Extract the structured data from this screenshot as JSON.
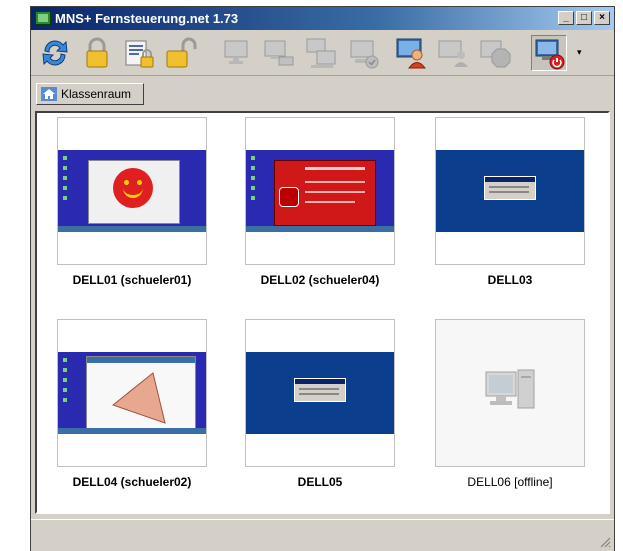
{
  "window": {
    "title": "MNS+ Fernsteuerung.net 1.73",
    "controls": {
      "minimize": "_",
      "maximize": "□",
      "close": "×"
    }
  },
  "toolbar": {
    "buttons": [
      {
        "icon": "refresh-icon",
        "enabled": true
      },
      {
        "icon": "lock-icon",
        "enabled": true
      },
      {
        "icon": "lock-document-icon",
        "enabled": true
      },
      {
        "icon": "unlock-icon",
        "enabled": true
      },
      {
        "icon": "computer-icon",
        "enabled": false
      },
      {
        "icon": "computer-network-icon",
        "enabled": false
      },
      {
        "icon": "computer-share-icon",
        "enabled": false
      },
      {
        "icon": "computer-check-icon",
        "enabled": false
      },
      {
        "icon": "user-view-icon",
        "enabled": true
      },
      {
        "icon": "computer-user-icon",
        "enabled": false
      },
      {
        "icon": "stop-icon",
        "enabled": false
      },
      {
        "icon": "power-off-icon",
        "enabled": true
      }
    ],
    "dropdown_glyph": "▾"
  },
  "tab": {
    "label": "Klassenraum",
    "icon": "home-icon"
  },
  "clients": [
    {
      "label": "DELL01 (schueler01)",
      "state": "smiley",
      "online": true
    },
    {
      "label": "DELL02 (schueler04)",
      "state": "stop-alert",
      "online": true
    },
    {
      "label": "DELL03",
      "state": "login",
      "online": true
    },
    {
      "label": "DELL04 (schueler02)",
      "state": "geometry",
      "online": true
    },
    {
      "label": "DELL05",
      "state": "login",
      "online": true
    },
    {
      "label": "DELL06 [offline]",
      "state": "offline",
      "online": false
    }
  ],
  "colors": {
    "desktop_blue": "#2a2ab0",
    "login_blue": "#0b3e8c",
    "alert_red": "#d01818"
  }
}
